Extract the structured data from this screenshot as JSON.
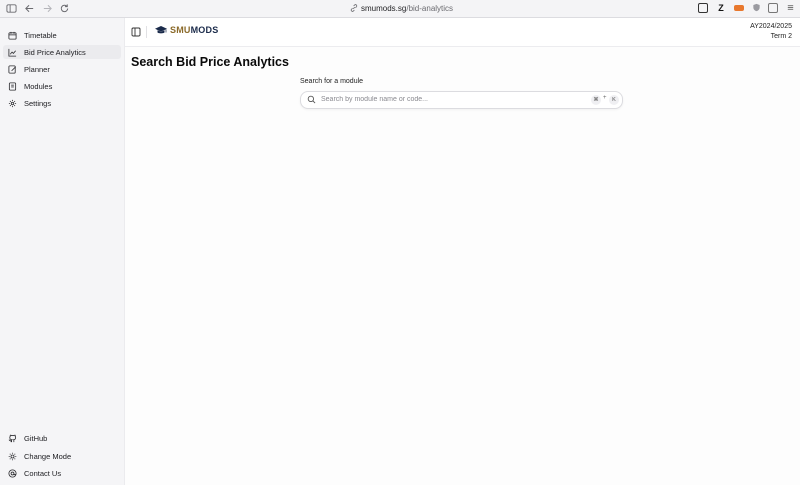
{
  "browser": {
    "url_host": "smumods.sg",
    "url_path": "/bid-analytics",
    "ext_z": "Z"
  },
  "sidebar": {
    "items": [
      {
        "label": "Timetable",
        "icon": "calendar-icon"
      },
      {
        "label": "Bid Price Analytics",
        "icon": "chart-icon"
      },
      {
        "label": "Planner",
        "icon": "planner-icon"
      },
      {
        "label": "Modules",
        "icon": "book-icon"
      },
      {
        "label": "Settings",
        "icon": "gear-icon"
      }
    ],
    "active_index": 1,
    "bottom_items": [
      {
        "label": "GitHub",
        "icon": "github-icon"
      },
      {
        "label": "Change Mode",
        "icon": "sun-icon"
      },
      {
        "label": "Contact Us",
        "icon": "contact-icon"
      }
    ]
  },
  "header": {
    "logo_smu": "SMU",
    "logo_mods": "MODS",
    "academic_year": "AY2024/2025",
    "term": "Term 2"
  },
  "main": {
    "title": "Search Bid Price Analytics",
    "search_label": "Search for a module",
    "search_placeholder": "Search by module name or code...",
    "search_value": "",
    "shortcut_key1": "⌘",
    "shortcut_plus": "+",
    "shortcut_key2": "K"
  },
  "colors": {
    "logo_smu": "#8b6a2a",
    "logo_mods": "#1a2a4a",
    "active_nav": "#ebebee",
    "ext_orange": "#e8782e"
  }
}
